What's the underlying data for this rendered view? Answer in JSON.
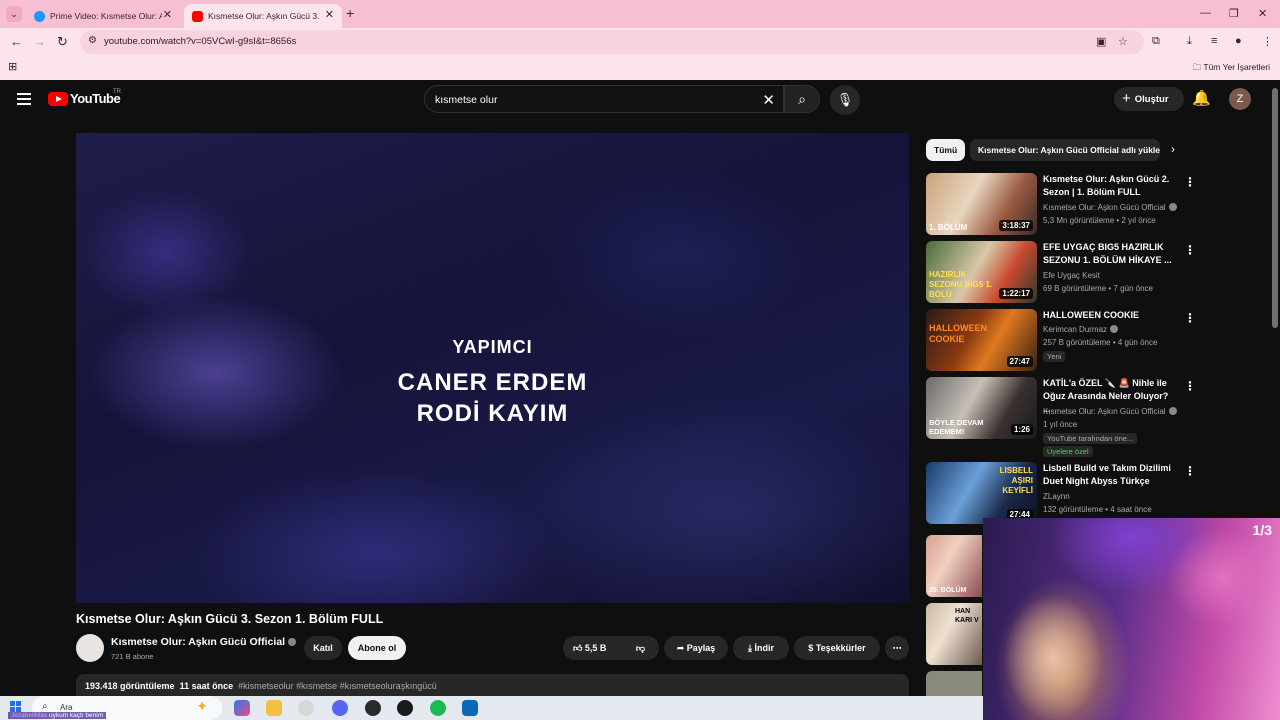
{
  "browser": {
    "tabs": [
      {
        "label": "Prime Video: Kısmetse Olur: Aşk",
        "active": false
      },
      {
        "label": "Kısmetse Olur: Aşkın Gücü 3. Se",
        "active": true
      }
    ],
    "url": "youtube.com/watch?v=05VCwI-g9sI&t=8656s",
    "bookmarks_label": "Tüm Yer İşaretleri"
  },
  "header": {
    "logo": "YouTube",
    "region": "TR",
    "search_value": "kısmetse olur",
    "create_label": "Oluştur",
    "avatar_letter": "Z"
  },
  "player": {
    "credit_role": "YAPIMCI",
    "credit_name_1": "CANER ERDEM",
    "credit_name_2": "RODİ KAYIM"
  },
  "video": {
    "title": "Kısmetse Olur: Aşkın Gücü 3. Sezon 1. Bölüm FULL",
    "channel": "Kısmetse Olur: Aşkın Gücü Official",
    "subscribers": "721 B abone",
    "join_label": "Katıl",
    "subscribe_label": "Abone ol",
    "likes": "5,5 B",
    "share_label": "Paylaş",
    "download_label": "İndir",
    "thanks_label": "Teşekkürler",
    "views": "193.418 görüntüleme",
    "age": "11 saat önce",
    "tags": "#kismetseolur #kısmetse #kısmetseoluraşkıngücü"
  },
  "sidebar": {
    "chips": [
      "Tümü",
      "Kısmetse Olur: Aşkın Gücü Official adlı yüklemeden"
    ],
    "recommendations": [
      {
        "title": "Kısmetse Olur: Aşkın Gücü 2. Sezon | 1. Bölüm  FULL",
        "channel": "Kısmetse Olur: Aşkın Gücü Official",
        "meta": "5,3 Mn görüntüleme • 2 yıl önce",
        "duration": "3:18:37",
        "thumb_text": "1. BÖLÜM"
      },
      {
        "title": "EFE UYGAÇ BIG5 HAZIRLIK SEZONU 1. BÖLÜM HİKAYE ...",
        "channel": "Efe Uygaç Kesit",
        "meta": "69 B görüntüleme • 7 gün önce",
        "duration": "1:22:17",
        "thumb_text": "HAZIRLIK SEZONU BIG5 1. BÖLÜ"
      },
      {
        "title": "HALLOWEEN COOKIE",
        "channel": "Kerimcan Durmaz",
        "meta": "257 B görüntüleme • 4 gün önce",
        "badge": "Yeni",
        "duration": "27:47",
        "thumb_text": "HALLOWEEN COOKIE"
      },
      {
        "title": "KATİL'a ÖZEL 🔪 🚨 Nihle ile Oğuz Arasında Neler Oluyor? ...",
        "channel": "Kısmetse Olur: Aşkın Gücü Official",
        "meta": "1 yıl önce",
        "badge": "YouTube tarafından öne...",
        "badge2": "Üyelere özel",
        "duration": "1:26",
        "thumb_text": "BÖYLE DEVAM EDEMEM!"
      },
      {
        "title": "Lisbell Build ve Takım Dizilimi Duet Night Abyss Türkçe",
        "channel": "ZLaynn",
        "meta": "132 görüntüleme • 4 saat önce",
        "duration": "27:44",
        "thumb_text": "LISBELL AŞIRI KEYİFLİ"
      }
    ],
    "partial_thumbs": [
      "29. BÖLÜM",
      "HAN KARI V"
    ]
  },
  "webcam": {
    "counter": "1/3"
  },
  "taskbar": {
    "search_placeholder": "Ara",
    "ticker": "uykum kaçtı benim",
    "ticker_prefix": "JezabeliMax"
  },
  "colors": {
    "youtube_red": "#ff0000",
    "tabbar": "#f6bfd3",
    "page_bg": "#0f0f0f"
  }
}
